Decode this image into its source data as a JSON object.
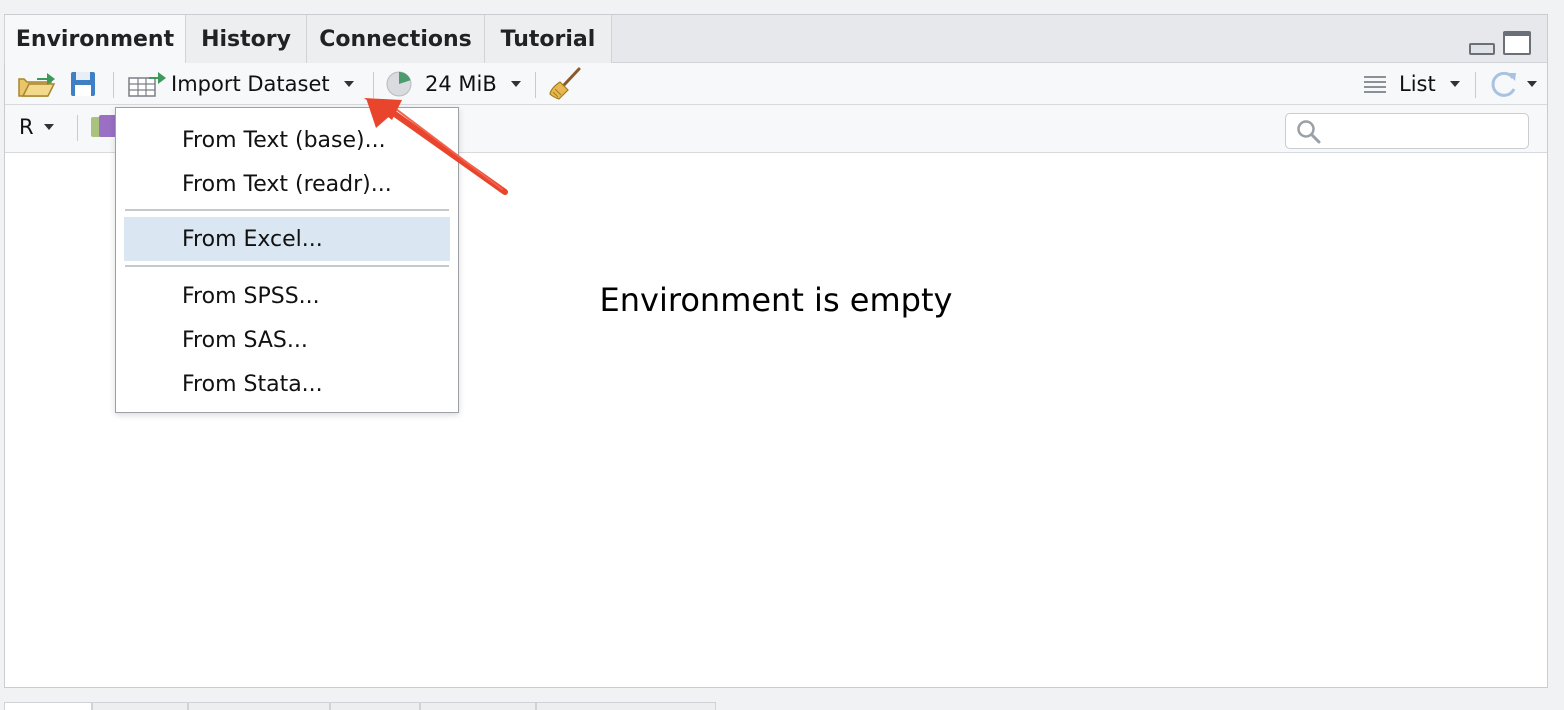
{
  "tabs": [
    {
      "label": "Environment",
      "active": true
    },
    {
      "label": "History",
      "active": false
    },
    {
      "label": "Connections",
      "active": false
    },
    {
      "label": "Tutorial",
      "active": false
    }
  ],
  "toolbar": {
    "import_label": "Import Dataset",
    "memory_label": "24 MiB",
    "view_label": "List"
  },
  "language": {
    "label": "R"
  },
  "search": {
    "placeholder": "",
    "value": ""
  },
  "main": {
    "empty_message": "Environment is empty"
  },
  "menu": {
    "items": [
      {
        "label": "From Text (base)...",
        "highlighted": false
      },
      {
        "label": "From Text (readr)...",
        "highlighted": false
      },
      {
        "label": "From Excel...",
        "highlighted": true
      },
      {
        "label": "From SPSS...",
        "highlighted": false
      },
      {
        "label": "From SAS...",
        "highlighted": false
      },
      {
        "label": "From Stata...",
        "highlighted": false
      }
    ]
  },
  "colors": {
    "highlight": "#dae6f2",
    "annotation_arrow": "#e8452c",
    "save_icon": "#3f7fc6",
    "memory_pie": "#4a9c6e"
  }
}
